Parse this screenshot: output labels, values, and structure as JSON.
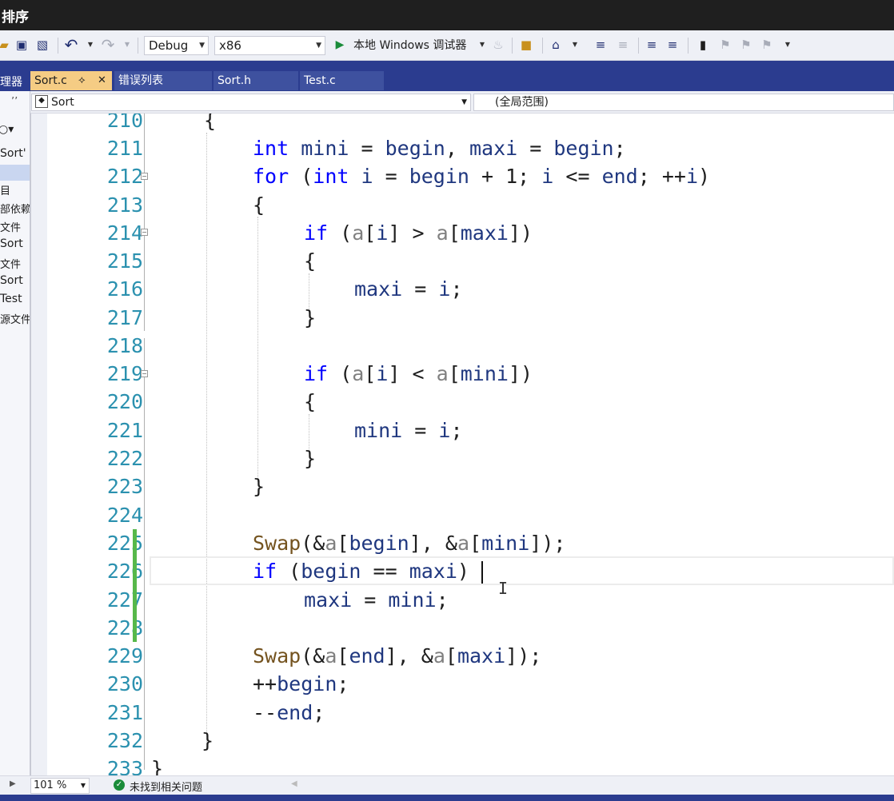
{
  "window": {
    "title": "排序"
  },
  "toolbar": {
    "config": "Debug",
    "platform": "x86",
    "run_label": "本地 Windows 调试器"
  },
  "tabs": [
    {
      "label": "Sort.c",
      "active": true
    },
    {
      "label": "错误列表",
      "active": false
    },
    {
      "label": "Sort.h",
      "active": false
    },
    {
      "label": "Test.c",
      "active": false
    }
  ],
  "solution_panel": {
    "title_fragment": "理器",
    "items": [
      "Sort'",
      "目",
      "部依赖",
      "文件",
      "Sort",
      "文件",
      "Sort",
      "Test",
      "源文件"
    ]
  },
  "navbar": {
    "scope_file": "Sort",
    "scope_global": "(全局范围)"
  },
  "editor": {
    "lines": [
      {
        "num": "210",
        "code": "{"
      },
      {
        "num": "211",
        "code": "int mini = begin, maxi = begin;"
      },
      {
        "num": "212",
        "code": "for (int i = begin + 1; i <= end; ++i)"
      },
      {
        "num": "213",
        "code": "{"
      },
      {
        "num": "214",
        "code": "if (a[i] > a[maxi])"
      },
      {
        "num": "215",
        "code": "{"
      },
      {
        "num": "216",
        "code": "maxi = i;"
      },
      {
        "num": "217",
        "code": "}"
      },
      {
        "num": "218",
        "code": ""
      },
      {
        "num": "219",
        "code": "if (a[i] < a[mini])"
      },
      {
        "num": "220",
        "code": "{"
      },
      {
        "num": "221",
        "code": "mini = i;"
      },
      {
        "num": "222",
        "code": "}"
      },
      {
        "num": "223",
        "code": "}"
      },
      {
        "num": "224",
        "code": ""
      },
      {
        "num": "225",
        "code": "Swap(&a[begin], &a[mini]);"
      },
      {
        "num": "226",
        "code": "if (begin == maxi)"
      },
      {
        "num": "227",
        "code": "maxi = mini;"
      },
      {
        "num": "228",
        "code": ""
      },
      {
        "num": "229",
        "code": "Swap(&a[end], &a[maxi]);"
      },
      {
        "num": "230",
        "code": "++begin;"
      },
      {
        "num": "231",
        "code": "--end;"
      },
      {
        "num": "232",
        "code": "}"
      },
      {
        "num": "233",
        "code": "}"
      }
    ]
  },
  "statusbar": {
    "zoom": "101 %",
    "issues": "未找到相关问题"
  },
  "colors": {
    "keyword": "#0000ff",
    "variable": "#1f377f",
    "parameter": "#808080",
    "function": "#74531f",
    "line_number": "#2b91af",
    "change_marker": "#57b84a"
  }
}
